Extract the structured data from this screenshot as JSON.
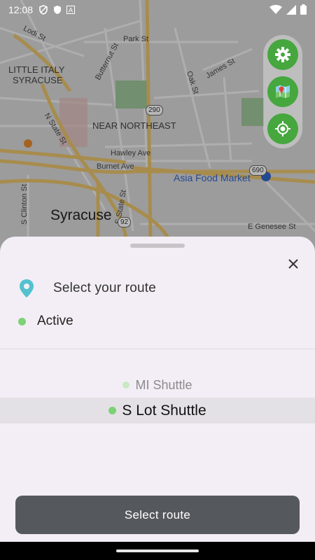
{
  "status_bar": {
    "time": "12:08",
    "left_icons": [
      "privacy-shield-icon",
      "shield-filled-icon",
      "letter-a-icon"
    ],
    "right_icons": [
      "wifi-icon",
      "signal-icon",
      "battery-icon"
    ]
  },
  "map": {
    "neighborhood_labels": [
      "LITTLE ITALY",
      "SYRACUSE",
      "NEAR NORTHEAST"
    ],
    "city_label": "Syracuse",
    "streets": [
      "Lodi St",
      "Park St",
      "Butternut St",
      "James St",
      "Oak St",
      "N State St",
      "Hawley Ave",
      "Burnet Ave",
      "S Clinton St",
      "S State St",
      "E Genesee St"
    ],
    "route_shields": [
      "290",
      "690",
      "92"
    ],
    "poi": "Asia Food Market",
    "accent_green": "#45a73e"
  },
  "map_controls": {
    "settings_icon": "gear-icon",
    "layers_icon": "map-icon",
    "locate_icon": "my-location-icon"
  },
  "sheet": {
    "title": "Select your route",
    "status_label": "Active",
    "status_color": "#7cd274",
    "routes": [
      {
        "name": "MI Shuttle",
        "selected": false
      },
      {
        "name": "S Lot Shuttle",
        "selected": true
      }
    ],
    "select_button": "Select route"
  }
}
